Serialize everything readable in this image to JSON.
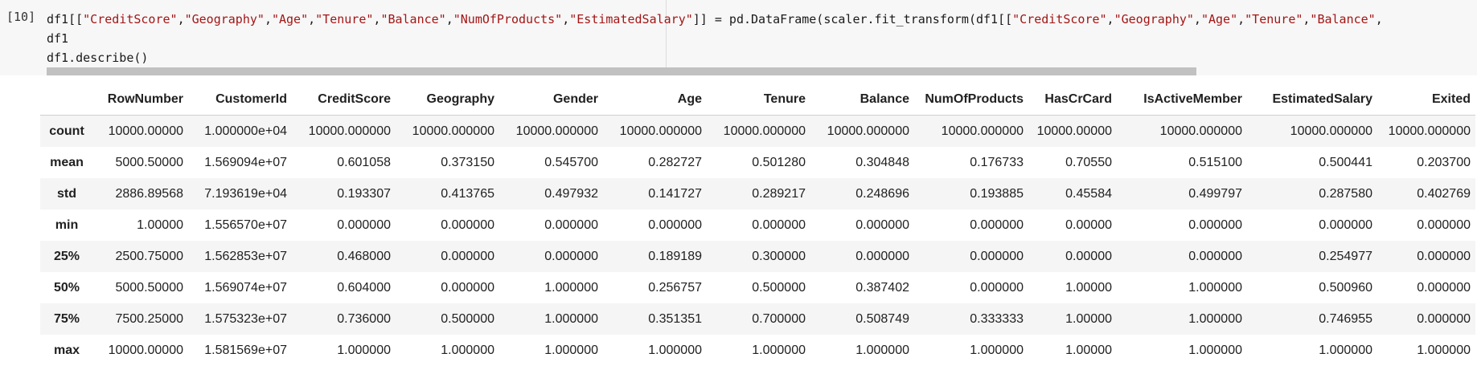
{
  "cell": {
    "prompt": "[10]",
    "code_lines": [
      [
        {
          "t": "df1[[",
          "c": "plain"
        },
        {
          "t": "\"CreditScore\"",
          "c": "str"
        },
        {
          "t": ",",
          "c": "plain"
        },
        {
          "t": "\"Geography\"",
          "c": "str"
        },
        {
          "t": ",",
          "c": "plain"
        },
        {
          "t": "\"Age\"",
          "c": "str"
        },
        {
          "t": ",",
          "c": "plain"
        },
        {
          "t": "\"Tenure\"",
          "c": "str"
        },
        {
          "t": ",",
          "c": "plain"
        },
        {
          "t": "\"Balance\"",
          "c": "str"
        },
        {
          "t": ",",
          "c": "plain"
        },
        {
          "t": "\"NumOfProducts\"",
          "c": "str"
        },
        {
          "t": ",",
          "c": "plain"
        },
        {
          "t": "\"EstimatedSalary\"",
          "c": "str"
        },
        {
          "t": "]] = pd.DataFrame(scaler.fit_transform(df1[[",
          "c": "plain"
        },
        {
          "t": "\"CreditScore\"",
          "c": "str"
        },
        {
          "t": ",",
          "c": "plain"
        },
        {
          "t": "\"Geography\"",
          "c": "str"
        },
        {
          "t": ",",
          "c": "plain"
        },
        {
          "t": "\"Age\"",
          "c": "str"
        },
        {
          "t": ",",
          "c": "plain"
        },
        {
          "t": "\"Tenure\"",
          "c": "str"
        },
        {
          "t": ",",
          "c": "plain"
        },
        {
          "t": "\"Balance\"",
          "c": "str"
        },
        {
          "t": ",",
          "c": "plain"
        }
      ],
      [
        {
          "t": "df1",
          "c": "plain"
        }
      ],
      [
        {
          "t": "df1.describe()",
          "c": "plain"
        }
      ]
    ],
    "colors": {
      "string": "#a31515",
      "background": "#f7f7f7"
    }
  },
  "table": {
    "columns": [
      "",
      "RowNumber",
      "CustomerId",
      "CreditScore",
      "Geography",
      "Gender",
      "Age",
      "Tenure",
      "Balance",
      "NumOfProducts",
      "HasCrCard",
      "IsActiveMember",
      "EstimatedSalary",
      "Exited"
    ],
    "rows": [
      {
        "label": "count",
        "values": [
          "10000.00000",
          "1.000000e+04",
          "10000.000000",
          "10000.000000",
          "10000.000000",
          "10000.000000",
          "10000.000000",
          "10000.000000",
          "10000.000000",
          "10000.00000",
          "10000.000000",
          "10000.000000",
          "10000.000000"
        ]
      },
      {
        "label": "mean",
        "values": [
          "5000.50000",
          "1.569094e+07",
          "0.601058",
          "0.373150",
          "0.545700",
          "0.282727",
          "0.501280",
          "0.304848",
          "0.176733",
          "0.70550",
          "0.515100",
          "0.500441",
          "0.203700"
        ]
      },
      {
        "label": "std",
        "values": [
          "2886.89568",
          "7.193619e+04",
          "0.193307",
          "0.413765",
          "0.497932",
          "0.141727",
          "0.289217",
          "0.248696",
          "0.193885",
          "0.45584",
          "0.499797",
          "0.287580",
          "0.402769"
        ]
      },
      {
        "label": "min",
        "values": [
          "1.00000",
          "1.556570e+07",
          "0.000000",
          "0.000000",
          "0.000000",
          "0.000000",
          "0.000000",
          "0.000000",
          "0.000000",
          "0.00000",
          "0.000000",
          "0.000000",
          "0.000000"
        ]
      },
      {
        "label": "25%",
        "values": [
          "2500.75000",
          "1.562853e+07",
          "0.468000",
          "0.000000",
          "0.000000",
          "0.189189",
          "0.300000",
          "0.000000",
          "0.000000",
          "0.00000",
          "0.000000",
          "0.254977",
          "0.000000"
        ]
      },
      {
        "label": "50%",
        "values": [
          "5000.50000",
          "1.569074e+07",
          "0.604000",
          "0.000000",
          "1.000000",
          "0.256757",
          "0.500000",
          "0.387402",
          "0.000000",
          "1.00000",
          "1.000000",
          "0.500960",
          "0.000000"
        ]
      },
      {
        "label": "75%",
        "values": [
          "7500.25000",
          "1.575323e+07",
          "0.736000",
          "0.500000",
          "1.000000",
          "0.351351",
          "0.700000",
          "0.508749",
          "0.333333",
          "1.00000",
          "1.000000",
          "0.746955",
          "0.000000"
        ]
      },
      {
        "label": "max",
        "values": [
          "10000.00000",
          "1.581569e+07",
          "1.000000",
          "1.000000",
          "1.000000",
          "1.000000",
          "1.000000",
          "1.000000",
          "1.000000",
          "1.00000",
          "1.000000",
          "1.000000",
          "1.000000"
        ]
      }
    ]
  }
}
